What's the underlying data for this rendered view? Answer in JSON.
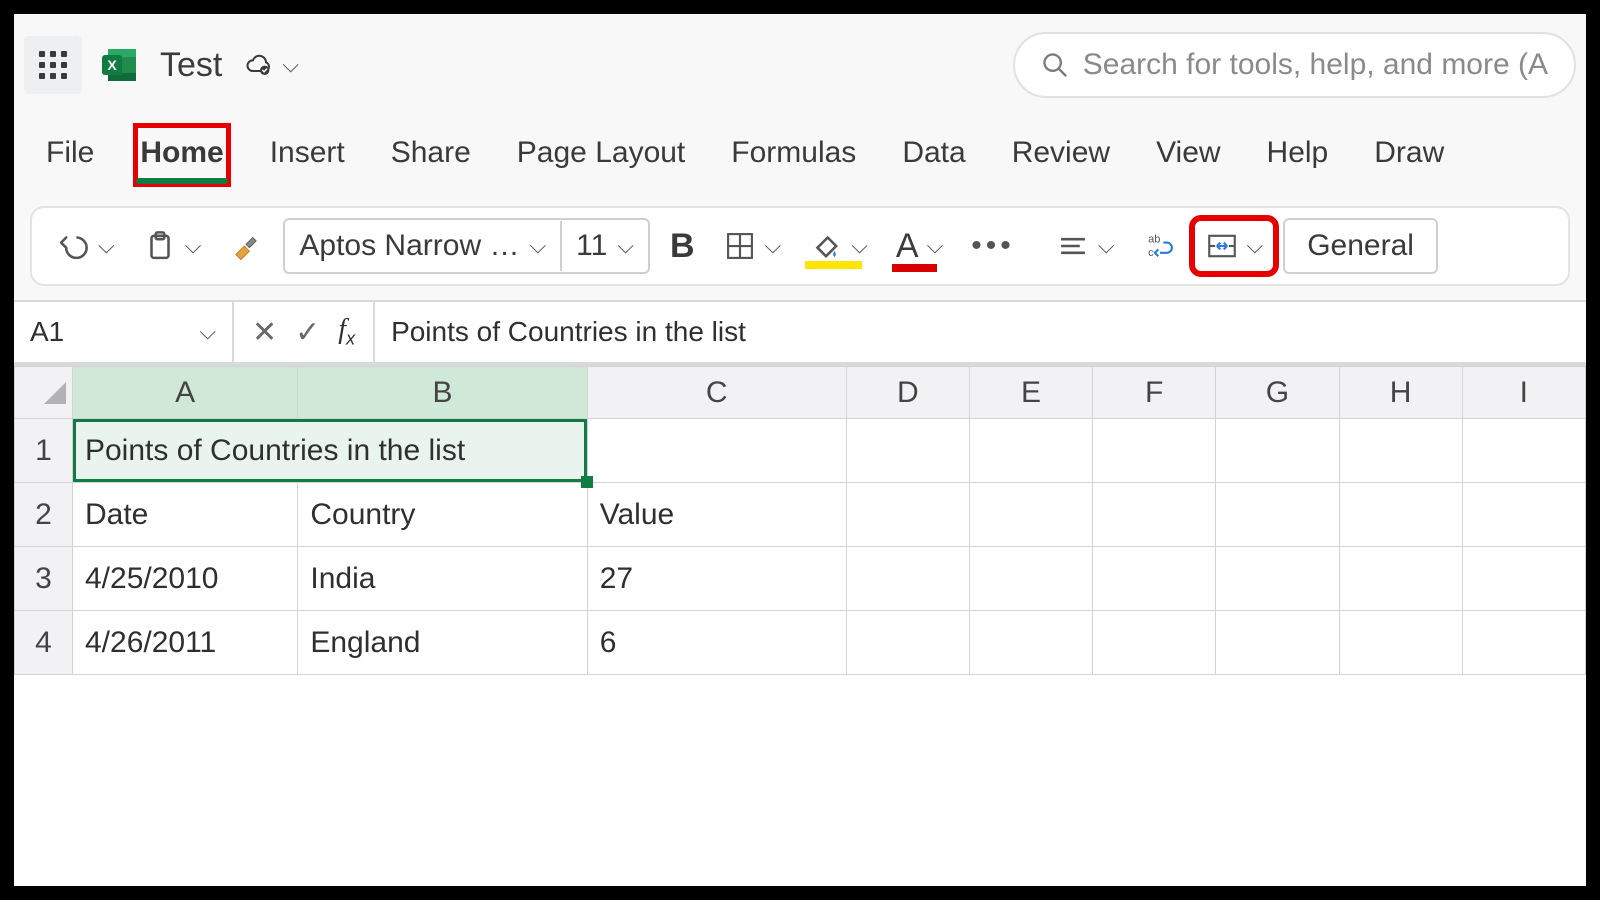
{
  "header": {
    "doc_title": "Test",
    "search_placeholder": "Search for tools, help, and more (A"
  },
  "tabs": {
    "items": [
      "File",
      "Home",
      "Insert",
      "Share",
      "Page Layout",
      "Formulas",
      "Data",
      "Review",
      "View",
      "Help",
      "Draw"
    ],
    "active": "Home"
  },
  "toolbar": {
    "font_name": "Aptos Narrow …",
    "font_size": "11",
    "number_format": "General"
  },
  "formula_bar": {
    "name_box": "A1",
    "formula": "Points of Countries in the list"
  },
  "grid": {
    "columns": [
      "A",
      "B",
      "C",
      "D",
      "E",
      "F",
      "G",
      "H",
      "I"
    ],
    "selected_columns": [
      "A",
      "B"
    ],
    "rows": [
      {
        "n": 1,
        "merged_AB": "Points of Countries in the list",
        "c": "",
        "rest": [
          "",
          "",
          "",
          "",
          "",
          ""
        ]
      },
      {
        "n": 2,
        "a": "Date",
        "b": "Country",
        "c": "Value",
        "rest": [
          "",
          "",
          "",
          "",
          "",
          ""
        ]
      },
      {
        "n": 3,
        "a": "4/25/2010",
        "b": "India",
        "c": "27",
        "rest": [
          "",
          "",
          "",
          "",
          "",
          ""
        ]
      },
      {
        "n": 4,
        "a": "4/26/2011",
        "b": "England",
        "c": "6",
        "rest": [
          "",
          "",
          "",
          "",
          "",
          ""
        ]
      }
    ]
  },
  "chart_data": {
    "type": "table",
    "title": "Points of Countries in the list",
    "columns": [
      "Date",
      "Country",
      "Value"
    ],
    "rows": [
      [
        "4/25/2010",
        "India",
        27
      ],
      [
        "4/26/2011",
        "England",
        6
      ]
    ]
  }
}
